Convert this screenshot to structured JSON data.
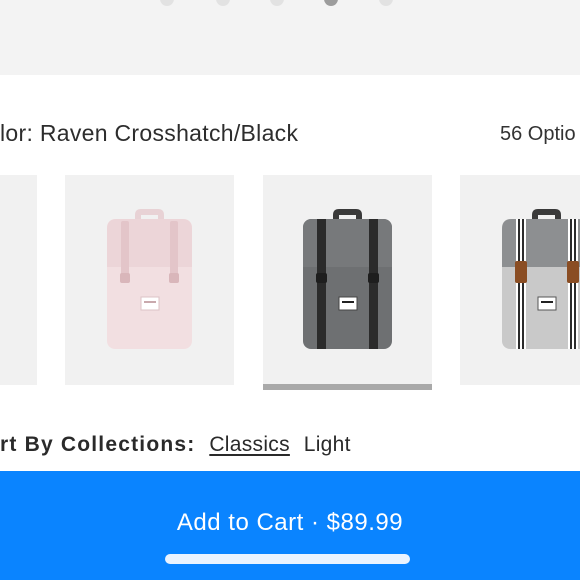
{
  "gallery": {
    "dots": [
      {
        "name": "page-dot-1",
        "active": false
      },
      {
        "name": "page-dot-2",
        "active": false
      },
      {
        "name": "page-dot-3",
        "active": false
      },
      {
        "name": "page-dot-4",
        "active": true
      },
      {
        "name": "page-dot-5",
        "active": false
      }
    ]
  },
  "color": {
    "label": "lor: Raven Crosshatch/Black",
    "options_count": "56 Optio"
  },
  "swatches": [
    {
      "name": "swatch-partial-left",
      "selected": false
    },
    {
      "name": "swatch-pink",
      "selected": false
    },
    {
      "name": "swatch-raven-crosshatch-black",
      "selected": true
    },
    {
      "name": "swatch-grey-stripe",
      "selected": false
    }
  ],
  "collections": {
    "label": "rt By Collections:",
    "options": [
      "Classics",
      "Light"
    ],
    "selected": "Classics"
  },
  "cart": {
    "button_label": "Add to Cart · $89.99"
  },
  "colors": {
    "primary": "#0a84ff",
    "swatch_bg": "#f1f1f1",
    "selected_indicator": "#a9a9a9"
  }
}
